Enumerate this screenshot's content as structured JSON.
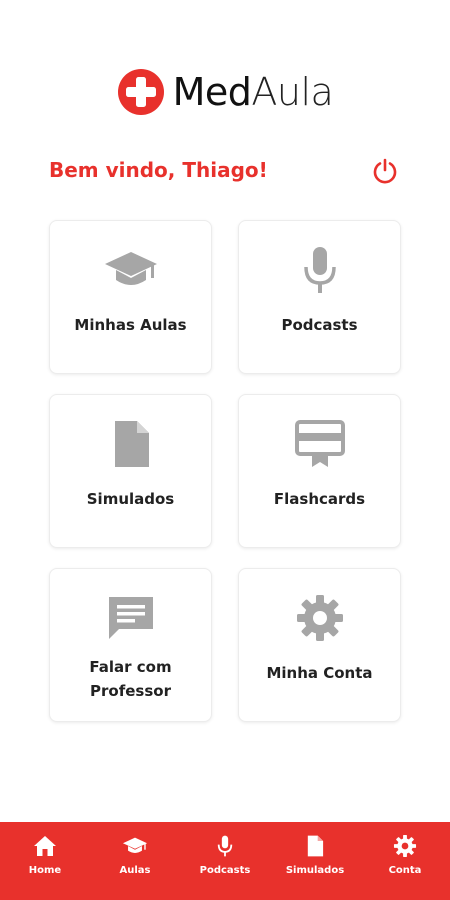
{
  "header": {
    "logo_text_bold": "Med",
    "logo_text_light": "Aula",
    "welcome": "Bem vindo, Thiago!",
    "power_icon": "power-icon"
  },
  "colors": {
    "accent": "#e8312c",
    "icon_gray": "#a6a6a6",
    "card_border": "#ececec"
  },
  "menu": {
    "minhas_aulas": {
      "label": "Minhas Aulas",
      "icon": "graduation-cap-icon"
    },
    "podcasts": {
      "label": "Podcasts",
      "icon": "microphone-icon"
    },
    "simulados": {
      "label": "Simulados",
      "icon": "document-icon"
    },
    "flashcards": {
      "label": "Flashcards",
      "icon": "flashcard-icon"
    },
    "falar_professor": {
      "label_line1": "Falar com",
      "label_line2": "Professor",
      "icon": "chat-icon"
    },
    "minha_conta": {
      "label": "Minha Conta",
      "icon": "gear-icon"
    }
  },
  "bottom_nav": {
    "home": {
      "label": "Home",
      "icon": "home-icon"
    },
    "aulas": {
      "label": "Aulas",
      "icon": "graduation-cap-icon"
    },
    "podcasts": {
      "label": "Podcasts",
      "icon": "microphone-icon"
    },
    "simulados": {
      "label": "Simulados",
      "icon": "document-icon"
    },
    "conta": {
      "label": "Conta",
      "icon": "gear-icon"
    }
  }
}
